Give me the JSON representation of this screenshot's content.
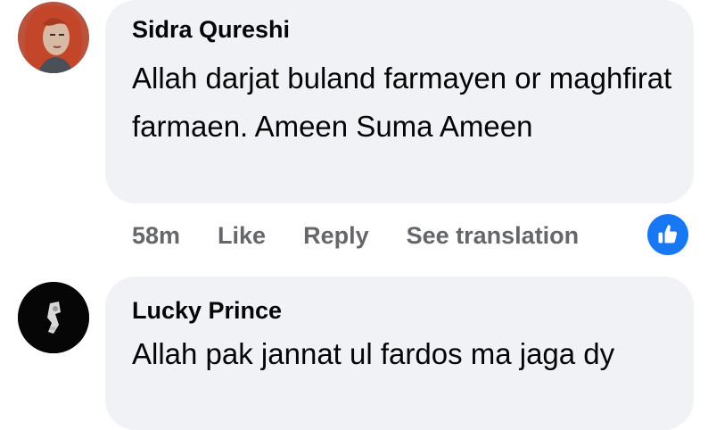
{
  "comments": [
    {
      "author": "Sidra Qureshi",
      "text": "Allah darjat buland farmayen or maghfirat farmaen. Ameen Suma Ameen",
      "time": "58m",
      "actions": {
        "like": "Like",
        "reply": "Reply",
        "translate": "See translation"
      },
      "avatar_icon": "painted-portrait-avatar",
      "reaction_icon": "thumbs-up-icon"
    },
    {
      "author": "Lucky Prince",
      "text": "Allah pak jannat ul fardos ma jaga dy",
      "avatar_icon": "dark-avatar"
    }
  ],
  "colors": {
    "bubble": "#f0f2f5",
    "text": "#050505",
    "meta": "#65676b",
    "like_blue": "#1877f2"
  }
}
